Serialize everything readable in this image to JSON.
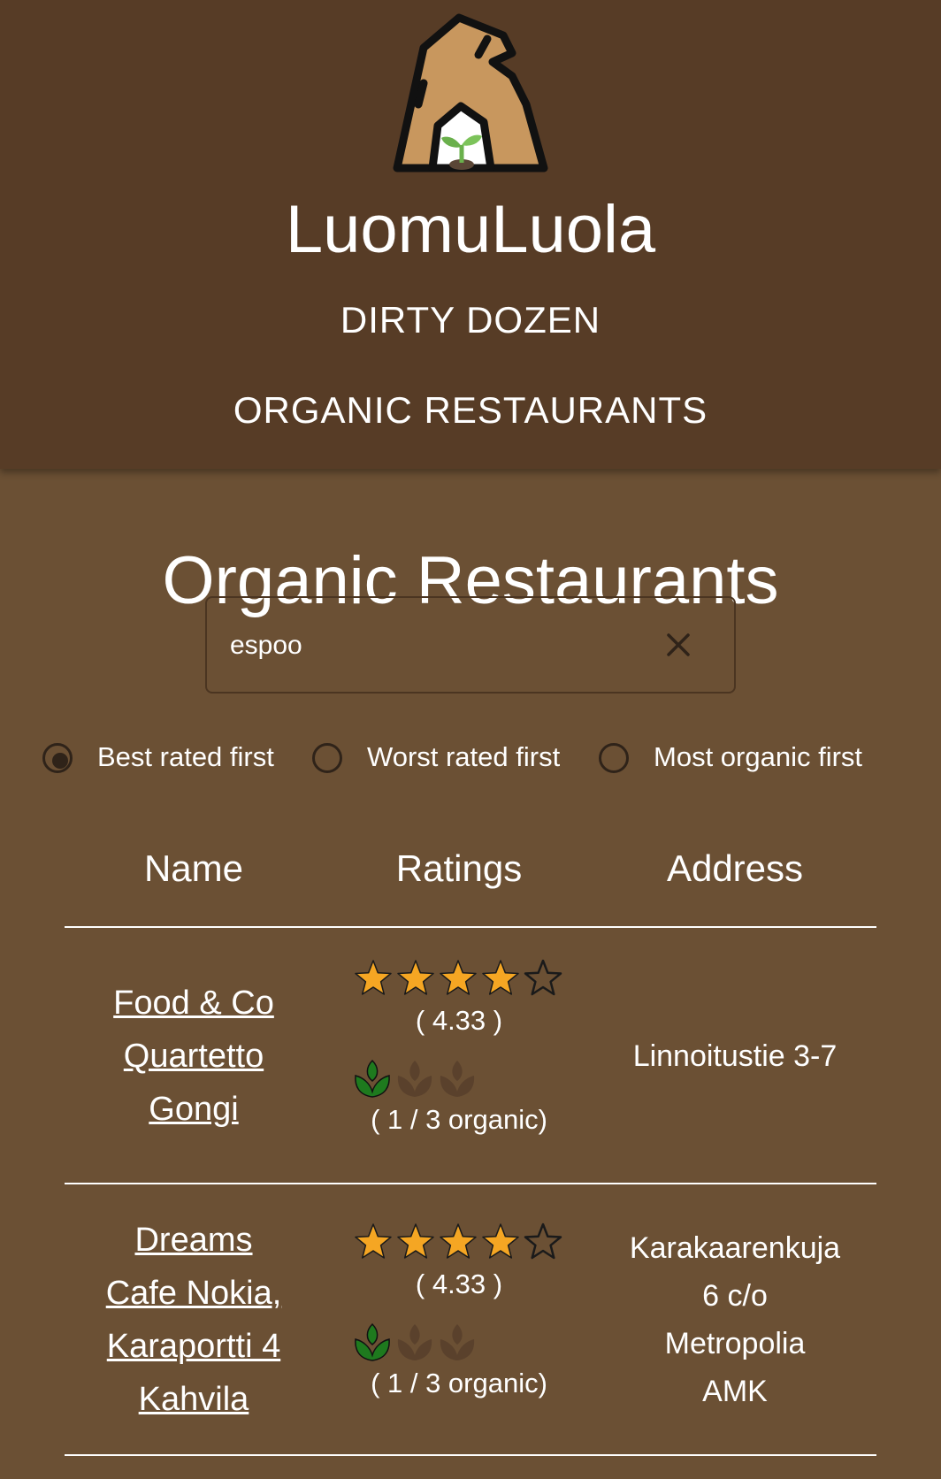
{
  "header": {
    "app_title": "LuomuLuola",
    "nav": [
      "DIRTY DOZEN",
      "ORGANIC RESTAURANTS"
    ]
  },
  "main": {
    "title": "Organic Restaurants",
    "search": {
      "value": "espoo",
      "placeholder": ""
    },
    "sort_options": [
      {
        "label": "Best rated first",
        "selected": true
      },
      {
        "label": "Worst rated first",
        "selected": false
      },
      {
        "label": "Most organic first",
        "selected": false
      }
    ],
    "table": {
      "headers": [
        "Name",
        "Ratings",
        "Address"
      ],
      "rows": [
        {
          "name_lines": [
            "Food & Co",
            "Quartetto",
            "Gongi"
          ],
          "stars_filled": 4,
          "stars_total": 5,
          "score": "( 4.33 )",
          "organic_filled": 1,
          "organic_total": 3,
          "organic_text": "( 1 / 3 organic)",
          "address_lines": [
            "Linnoitustie 3-7"
          ]
        },
        {
          "name_lines": [
            "Dreams",
            "Cafe  Nokia,",
            "Karaportti 4",
            "Kahvila"
          ],
          "stars_filled": 4,
          "stars_total": 5,
          "score": "( 4.33 )",
          "organic_filled": 1,
          "organic_total": 3,
          "organic_text": "( 1 / 3 organic)",
          "address_lines": [
            "Karakaarenkuja",
            "6 c/o",
            "Metropolia",
            "AMK"
          ]
        }
      ]
    }
  },
  "colors": {
    "header_bg": "#573c26",
    "page_bg": "#6b5034",
    "star": "#f5a623",
    "leaf_active": "#1e7a1e",
    "leaf_inactive": "#5a412c"
  },
  "icons": [
    "logo-cave-sprout",
    "close-icon",
    "star-icon",
    "leaf-icon"
  ]
}
